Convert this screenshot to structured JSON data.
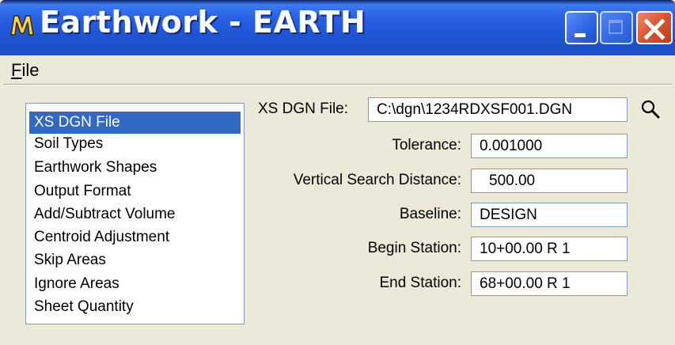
{
  "window": {
    "title": "Earthwork - EARTH"
  },
  "menu": {
    "items": [
      {
        "label_underlined": "F",
        "label_rest": "ile"
      }
    ]
  },
  "nav_list": {
    "items": [
      {
        "label": "XS DGN File",
        "selected": true
      },
      {
        "label": "Soil Types"
      },
      {
        "label": "Earthwork Shapes"
      },
      {
        "label": "Output Format"
      },
      {
        "label": "Add/Subtract Volume"
      },
      {
        "label": "Centroid Adjustment"
      },
      {
        "label": "Skip Areas"
      },
      {
        "label": "Ignore Areas"
      },
      {
        "label": "Sheet Quantity"
      }
    ]
  },
  "form": {
    "xs_dgn_file": {
      "label": "XS DGN File:",
      "value": "C:\\dgn\\1234RDXSF001.DGN"
    },
    "tolerance": {
      "label": "Tolerance:",
      "value": "0.001000"
    },
    "vertical_search_distance": {
      "label": "Vertical Search Distance:",
      "value": "500.00"
    },
    "baseline": {
      "label": "Baseline:",
      "value": "DESIGN"
    },
    "begin_station": {
      "label": "Begin Station:",
      "value": "10+00.00 R 1"
    },
    "end_station": {
      "label": "End Station:",
      "value": "68+00.00 R 1"
    }
  },
  "colors": {
    "title_bar": "#2b62e6",
    "selection": "#316ac5",
    "dialog_bg": "#ece9d8",
    "close_button": "#d9542f"
  },
  "icons": {
    "app": "microstation-app-icon",
    "minimize": "minimize-icon",
    "maximize": "maximize-icon",
    "close": "close-icon",
    "browse": "magnifier-icon"
  }
}
